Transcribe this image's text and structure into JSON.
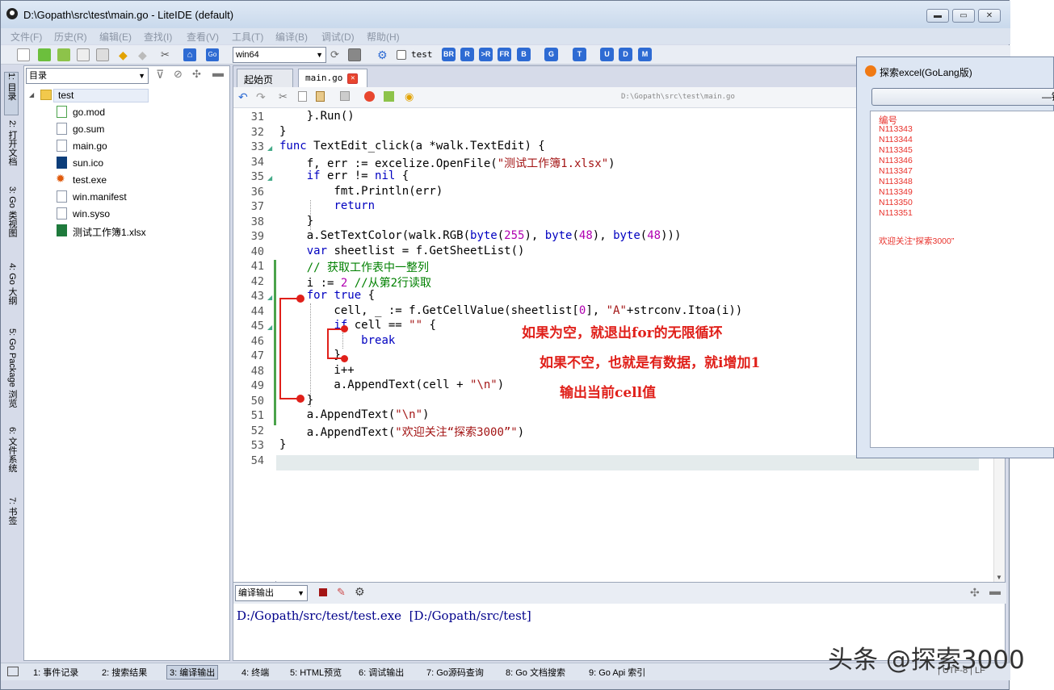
{
  "window": {
    "title": "D:\\Gopath\\src\\test\\main.go - LiteIDE (default)",
    "min": "▬",
    "max": "▭",
    "close": "✕"
  },
  "menu": [
    "文件(F)",
    "历史(R)",
    "编辑(E)",
    "查找(I)",
    "查看(V)",
    "工具(T)",
    "编译(B)",
    "调试(D)",
    "帮助(H)"
  ],
  "toolbar": {
    "env": "win64",
    "build_target_checkbox": "test",
    "build_buttons": [
      "BR",
      "R",
      ">R",
      "FR",
      "B",
      "G",
      "T",
      "U",
      "D",
      "M"
    ]
  },
  "sidebar": {
    "tabs": [
      "1: 目录",
      "2: 打开文档",
      "3: Go 类视图",
      "4: Go 大纲",
      "5: Go Package 浏览",
      "6: 文件系统",
      "7: 书签"
    ],
    "combo": "目录",
    "root": "test",
    "files": [
      "go.mod",
      "go.sum",
      "main.go",
      "sun.ico",
      "test.exe",
      "win.manifest",
      "win.syso",
      "测试工作簿1.xlsx"
    ]
  },
  "editor": {
    "tabs": [
      "起始页",
      "main.go"
    ],
    "path": "D:\\Gopath\\src\\test\\main.go",
    "line_numbers": [
      "31",
      "32",
      "33",
      "34",
      "35",
      "36",
      "37",
      "38",
      "39",
      "40",
      "41",
      "42",
      "43",
      "44",
      "45",
      "46",
      "47",
      "48",
      "49",
      "50",
      "51",
      "52",
      "53",
      "54"
    ]
  },
  "code": [
    {
      "segments": [
        [
          "t",
          "    }.Run()"
        ]
      ]
    },
    {
      "segments": [
        [
          "t",
          "}"
        ]
      ]
    },
    {
      "segments": [
        [
          "k",
          "func"
        ],
        [
          "t",
          " TextEdit_click(a *walk.TextEdit) {"
        ]
      ]
    },
    {
      "segments": [
        [
          "t",
          "    f, err := excelize.OpenFile("
        ],
        [
          "s",
          "\"测试工作簿1.xlsx\""
        ],
        [
          "t",
          ")"
        ]
      ]
    },
    {
      "segments": [
        [
          "t",
          "    "
        ],
        [
          "k",
          "if"
        ],
        [
          "t",
          " err != "
        ],
        [
          "k",
          "nil"
        ],
        [
          "t",
          " {"
        ]
      ]
    },
    {
      "segments": [
        [
          "t",
          "        fmt.Println(err)"
        ]
      ]
    },
    {
      "segments": [
        [
          "t",
          "        "
        ],
        [
          "k",
          "return"
        ]
      ]
    },
    {
      "segments": [
        [
          "t",
          "    }"
        ]
      ]
    },
    {
      "segments": [
        [
          "t",
          "    a.SetTextColor(walk.RGB("
        ],
        [
          "k",
          "byte"
        ],
        [
          "t",
          "("
        ],
        [
          "n",
          "255"
        ],
        [
          "t",
          "), "
        ],
        [
          "k",
          "byte"
        ],
        [
          "t",
          "("
        ],
        [
          "n",
          "48"
        ],
        [
          "t",
          "), "
        ],
        [
          "k",
          "byte"
        ],
        [
          "t",
          "("
        ],
        [
          "n",
          "48"
        ],
        [
          "t",
          ")))"
        ]
      ]
    },
    {
      "segments": [
        [
          "t",
          "    "
        ],
        [
          "k",
          "var"
        ],
        [
          "t",
          " sheetlist = f.GetSheetList()"
        ]
      ]
    },
    {
      "segments": [
        [
          "c",
          "    // 获取工作表中一整列"
        ]
      ]
    },
    {
      "segments": [
        [
          "t",
          "    i := "
        ],
        [
          "n",
          "2"
        ],
        [
          "t",
          " "
        ],
        [
          "c",
          "//从第2行读取"
        ]
      ]
    },
    {
      "segments": [
        [
          "t",
          "    "
        ],
        [
          "k",
          "for"
        ],
        [
          "t",
          " "
        ],
        [
          "k",
          "true"
        ],
        [
          "t",
          " {"
        ]
      ]
    },
    {
      "segments": [
        [
          "t",
          "        cell, _ := f.GetCellValue(sheetlist["
        ],
        [
          "n",
          "0"
        ],
        [
          "t",
          "], "
        ],
        [
          "s",
          "\"A\""
        ],
        [
          "t",
          "+strconv.Itoa(i))"
        ]
      ]
    },
    {
      "segments": [
        [
          "t",
          "        "
        ],
        [
          "k",
          "if"
        ],
        [
          "t",
          " cell == "
        ],
        [
          "s",
          "\"\""
        ],
        [
          "t",
          " {"
        ]
      ]
    },
    {
      "segments": [
        [
          "t",
          "            "
        ],
        [
          "k",
          "break"
        ]
      ]
    },
    {
      "segments": [
        [
          "t",
          "        }"
        ]
      ]
    },
    {
      "segments": [
        [
          "t",
          "        i++"
        ]
      ]
    },
    {
      "segments": [
        [
          "t",
          "        a.AppendText(cell + "
        ],
        [
          "s",
          "\"\\n\""
        ],
        [
          "t",
          ")"
        ]
      ]
    },
    {
      "segments": [
        [
          "t",
          "    }"
        ]
      ]
    },
    {
      "segments": [
        [
          "t",
          "    a.AppendText("
        ],
        [
          "s",
          "\"\\n\""
        ],
        [
          "t",
          ")"
        ]
      ]
    },
    {
      "segments": [
        [
          "t",
          "    a.AppendText("
        ],
        [
          "s",
          "\"欢迎关注“探索3000”\""
        ],
        [
          "t",
          ")"
        ]
      ]
    },
    {
      "segments": [
        [
          "t",
          "}"
        ]
      ]
    },
    {
      "segments": [
        [
          "t",
          ""
        ]
      ]
    }
  ],
  "annotations": [
    "如果为空，就退出for的无限循环",
    "如果不空，也就是有数据，就i增加1",
    "输出当前cell值"
  ],
  "output": {
    "combo": "编译输出",
    "text": "D:/Gopath/src/test/test.exe  [D:/Gopath/src/test]"
  },
  "statusbar": {
    "tabs": [
      "1: 事件记录",
      "2: 搜索结果",
      "3: 编译输出",
      "4: 终端",
      "5: HTML预览",
      "6: 调试输出",
      "7: Go源码查询",
      "8: Go 文档搜索",
      "9: Go Api 索引"
    ],
    "right": "| UTF-8 | LF"
  },
  "watermark": "头条 @探索3000",
  "popup": {
    "title": "探索excel(GoLang版)",
    "button": "—键",
    "lines": [
      "编号",
      "N113343",
      "N113344",
      "N113345",
      "N113346",
      "N113347",
      "N113348",
      "N113349",
      "N113350",
      "N113351",
      "",
      "欢迎关注“探索3000”"
    ]
  },
  "colors": {
    "keyword": "#0000c0",
    "string": "#a31515",
    "comment": "#008000",
    "annotation": "#e0201a",
    "popup_text": "#e8302a"
  }
}
